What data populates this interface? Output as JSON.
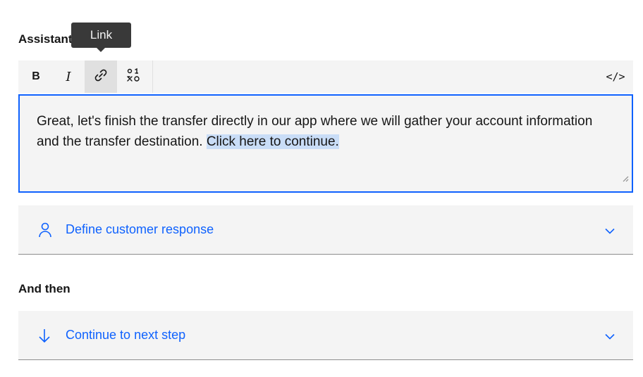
{
  "assistant_section": {
    "title": "Assistant says"
  },
  "tooltip": {
    "text": "Link"
  },
  "toolbar": {
    "bold_label": "B",
    "italic_label": "I",
    "link_icon": "link-icon",
    "variable_icon": "variable-icon",
    "code_label": "</>"
  },
  "editor": {
    "text_before": "Great, let's finish the transfer directly in our app where we will gather your account information and the transfer destination. ",
    "link_text": "Click here to continue."
  },
  "customer_response": {
    "label": "Define customer response",
    "icon": "user-icon"
  },
  "and_then": {
    "title": "And then"
  },
  "next_step": {
    "label": "Continue to next step",
    "icon": "arrow-down-icon"
  },
  "colors": {
    "accent": "#0f62fe",
    "selection": "#c9ddf7",
    "surface": "#f4f4f4",
    "tooltip": "#393939"
  }
}
